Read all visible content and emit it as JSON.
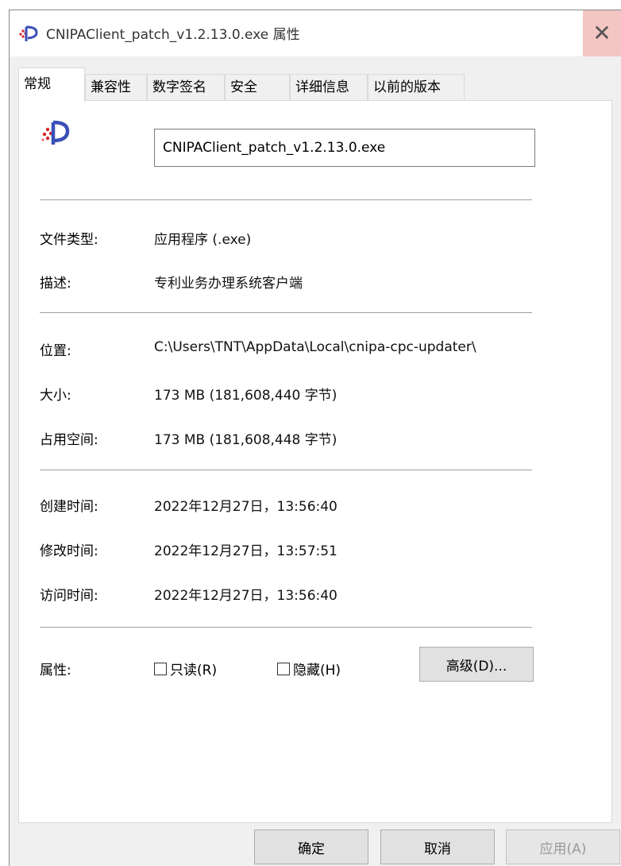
{
  "window": {
    "title": "CNIPAClient_patch_v1.2.13.0.exe 属性",
    "close_symbol": "✕"
  },
  "tabs": [
    "常规",
    "兼容性",
    "数字签名",
    "安全",
    "详细信息",
    "以前的版本"
  ],
  "general": {
    "file_name": "CNIPAClient_patch_v1.2.13.0.exe",
    "fields": [
      {
        "label": "文件类型:",
        "value": "应用程序 (.exe)"
      },
      {
        "label": "描述:",
        "value": "专利业务办理系统客户端"
      },
      {
        "label": "位置:",
        "value": "C:\\Users\\TNT\\AppData\\Local\\cnipa-cpc-updater\\"
      },
      {
        "label": "大小:",
        "value": "173 MB (181,608,440 字节)"
      },
      {
        "label": "占用空间:",
        "value": "173 MB (181,608,448 字节)"
      },
      {
        "label": "创建时间:",
        "value": "2022年12月27日，13:56:40"
      },
      {
        "label": "修改时间:",
        "value": "2022年12月27日，13:57:51"
      },
      {
        "label": "访问时间:",
        "value": "2022年12月27日，13:56:40"
      }
    ],
    "attributes": {
      "label": "属性:",
      "readonly_label": "只读(R)",
      "readonly_checked": false,
      "hidden_label": "隐藏(H)",
      "hidden_checked": false,
      "advanced_button": "高级(D)..."
    }
  },
  "footer": {
    "ok": "确定",
    "cancel": "取消",
    "apply": "应用(A)"
  },
  "colors": {
    "close_hover": "#f3c5c3",
    "icon_blue": "#3a4fb8",
    "icon_red": "#d8232a"
  },
  "icons": [
    "app-logo-icon",
    "close-icon"
  ]
}
